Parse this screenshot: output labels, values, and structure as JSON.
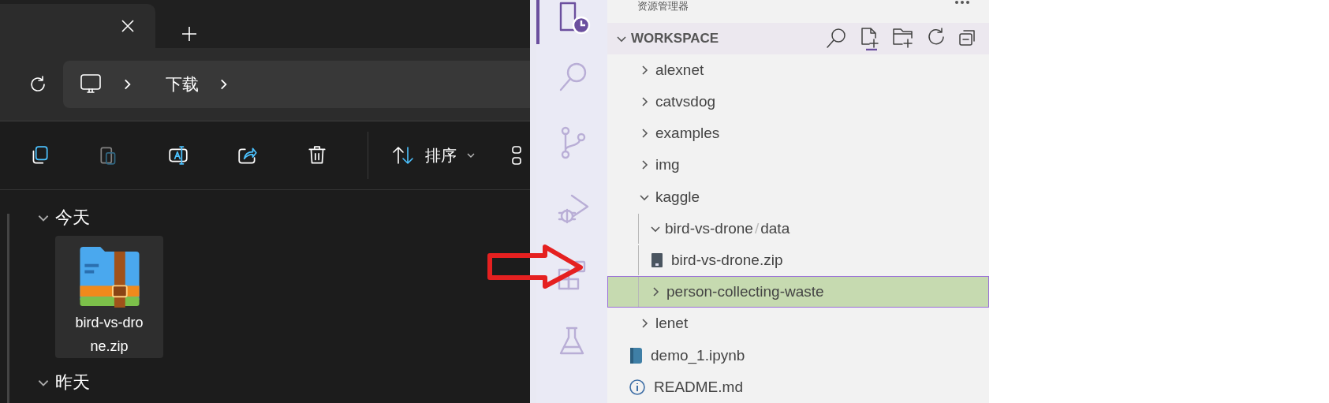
{
  "file_explorer": {
    "breadcrumb": [
      "下载"
    ],
    "toolbar": [
      {
        "kind": "copy",
        "disabled": false
      },
      {
        "kind": "paste",
        "disabled": true
      },
      {
        "kind": "rename",
        "disabled": false
      },
      {
        "kind": "share",
        "disabled": false
      },
      {
        "kind": "delete",
        "disabled": false
      }
    ],
    "sort_button": {
      "label": "排序"
    },
    "groups": [
      {
        "label": "今天",
        "expanded": true,
        "files": [
          {
            "name": "bird-vs-drone.zip",
            "selected": true
          }
        ]
      },
      {
        "label": "昨天",
        "expanded": true
      }
    ]
  },
  "vscode": {
    "activity_bar": [
      {
        "kind": "explorer",
        "selected": true
      },
      {
        "kind": "search",
        "selected": false
      },
      {
        "kind": "source-control",
        "selected": false
      },
      {
        "kind": "run-debug",
        "selected": false
      },
      {
        "kind": "extensions",
        "selected": false
      },
      {
        "kind": "testing",
        "selected": false
      }
    ],
    "sidebar": {
      "title": "资源管理器",
      "section": {
        "title": "WORKSPACE",
        "expanded": true,
        "tree": [
          {
            "kind": "folder",
            "label": "alexnet",
            "expanded": false,
            "selected": false
          },
          {
            "kind": "folder",
            "label": "catvsdog",
            "expanded": false,
            "selected": false
          },
          {
            "kind": "folder",
            "label": "examples",
            "expanded": false,
            "selected": false
          },
          {
            "kind": "folder",
            "label": "img",
            "expanded": false,
            "selected": false
          },
          {
            "kind": "folder",
            "label": "kaggle",
            "expanded": true,
            "selected": false,
            "children": [
              {
                "kind": "folder",
                "path": [
                  "bird-vs-drone",
                  "data"
                ],
                "separator": "/",
                "expanded": true,
                "selected": false,
                "children": [
                  {
                    "kind": "zip",
                    "label": "bird-vs-drone.zip",
                    "selected": false
                  }
                ]
              },
              {
                "kind": "folder",
                "label": "person-collecting-waste",
                "expanded": false,
                "selected": true
              }
            ]
          },
          {
            "kind": "folder",
            "label": "lenet",
            "expanded": false,
            "selected": false
          },
          {
            "kind": "notebook",
            "label": "demo_1.ipynb",
            "selected": false
          },
          {
            "kind": "info",
            "label": "README.md",
            "selected": false
          }
        ]
      }
    }
  }
}
